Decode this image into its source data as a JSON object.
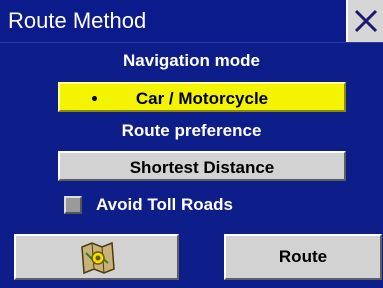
{
  "window": {
    "title": "Route Method",
    "close_icon": "close-icon"
  },
  "navigation_mode": {
    "label": "Navigation mode",
    "selected_value": "Car / Motorcycle"
  },
  "route_preference": {
    "label": "Route preference",
    "selected_value": "Shortest Distance"
  },
  "options": {
    "avoid_toll_roads": {
      "label": "Avoid Toll Roads",
      "checked": false
    }
  },
  "footer": {
    "map_button_icon": "map-icon",
    "route_button_label": "Route"
  },
  "colors": {
    "background": "#0d1d8a",
    "highlight": "#f4f400",
    "button": "#d2d2d2"
  }
}
